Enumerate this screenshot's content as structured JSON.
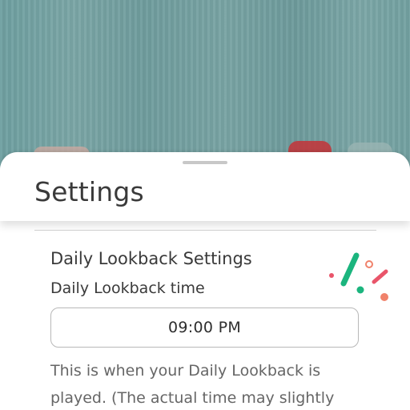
{
  "settings_sheet": {
    "title": "Settings",
    "section_heading": "Daily Lookback Settings",
    "time_label": "Daily Lookback time",
    "time_value": "09:00 PM",
    "help_text": "This is when your Daily Lookback is played. (The actual time may slightly"
  },
  "colors": {
    "background_teal": "#6e9fa0",
    "sheet": "#ffffff",
    "text_dark": "#3a3a3a",
    "text_muted": "#666666",
    "confetti_green": "#1bb57e",
    "confetti_coral": "#f0826b",
    "confetti_red": "#e9556a",
    "background_red_button": "#c0393d"
  },
  "icons": {
    "decoration": "confetti-icon",
    "sheet_handle": "drag-handle"
  }
}
